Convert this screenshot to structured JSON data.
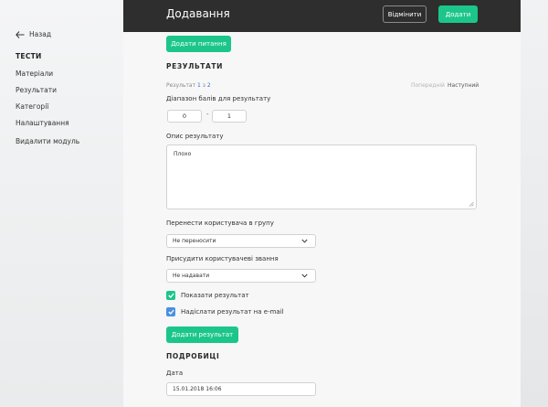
{
  "sidebar": {
    "back_label": "Назад",
    "section_title": "ТЕСТИ",
    "items": [
      {
        "label": "Матеріали"
      },
      {
        "label": "Результати"
      },
      {
        "label": "Категорії"
      },
      {
        "label": "Налаштування"
      },
      {
        "label": "Видалити модуль"
      }
    ]
  },
  "header": {
    "title": "Додавання",
    "cancel_label": "Відмінити",
    "add_label": "Додати"
  },
  "main": {
    "add_question_label": "Додати питання",
    "results_heading": "РЕЗУЛЬТАТИ",
    "pager": {
      "prefix": "Результат",
      "current": "1",
      "of": "з",
      "total": "2",
      "prev_label": "Попередній",
      "next_label": "Наступний"
    },
    "score_range_label": "Діапазон балів для результату",
    "score_from": "0",
    "score_to": "1",
    "score_sep": "-",
    "description_label": "Опис результату",
    "description_value": "Плохо",
    "group_label": "Перенести користувача в групу",
    "group_value": "Не переносити",
    "rank_label": "Присудити користувачеві звання",
    "rank_value": "Не надавати",
    "show_result_label": "Показати результат",
    "email_result_label": "Надіслати результат на e-mail",
    "add_result_label": "Додати результат",
    "details_heading": "ПОДРОБИЦІ",
    "date_label": "Дата",
    "date_value": "15.01.2018 16:06"
  },
  "colors": {
    "accent_green": "#1cc68a",
    "checkbox_green": "#1cc68a",
    "checkbox_blue": "#4a90e2",
    "topbar": "#2e2e2e"
  },
  "icons": {
    "back": "arrow-left-icon",
    "select": "chevron-down-icon",
    "check": "check-icon"
  }
}
